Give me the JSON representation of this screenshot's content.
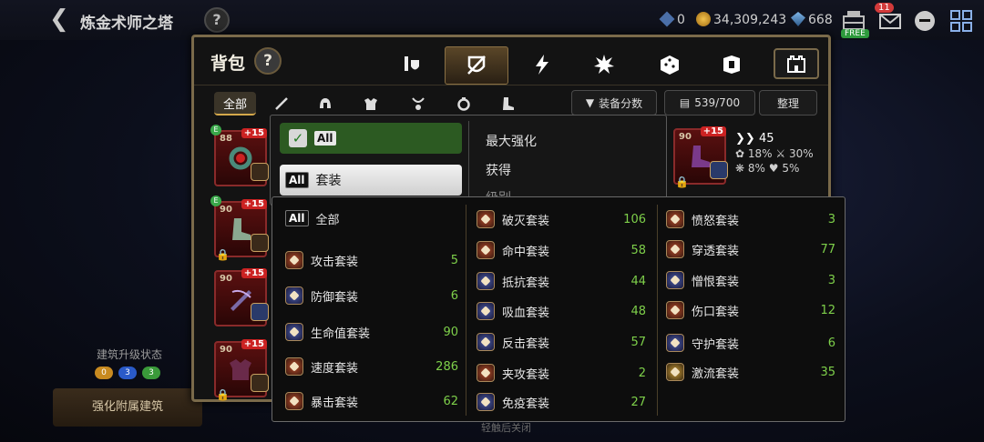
{
  "header": {
    "title": "炼金术师之塔",
    "help": "?",
    "resources": [
      {
        "icon": "blue-gem-icon",
        "value": "0"
      },
      {
        "icon": "gold-coin-icon",
        "value": "34,309,243"
      },
      {
        "icon": "crystal-icon",
        "value": "668"
      }
    ],
    "free_label": "FREE",
    "mail_badge": "11"
  },
  "background": {
    "building_status": "建筑升级状态",
    "dots": [
      "0",
      "3",
      "3"
    ],
    "strengthen_button": "强化附属建筑",
    "close_hint": "轻触后关闭"
  },
  "bag": {
    "title": "背包",
    "help": "?",
    "category_tabs": [
      "weapon-shield-icon",
      "armor-crossed-icon",
      "lightning-icon",
      "burst-icon",
      "dice-icon",
      "cube-icon",
      "castle-icon"
    ],
    "slot_tabs": [
      "全部",
      "sword-icon",
      "helmet-icon",
      "chest-armor-icon",
      "necklace-icon",
      "ring-icon",
      "boots-icon"
    ],
    "sort_button": "装备分数",
    "capacity": "539/700",
    "arrange_button": "整理",
    "items": [
      {
        "level": "88",
        "plus": "+15",
        "e": "E",
        "locked": false
      },
      {
        "level": "90",
        "plus": "+15",
        "e": "E",
        "locked": true
      },
      {
        "level": "90",
        "plus": "+15",
        "e": "",
        "locked": false
      },
      {
        "level": "90",
        "plus": "+15",
        "e": "",
        "locked": true
      }
    ],
    "right_item": {
      "level": "90",
      "plus": "+15",
      "locked": true
    },
    "stats": {
      "main": "45",
      "s1": "18%",
      "s2": "30%",
      "s3": "8%",
      "s4": "5%"
    }
  },
  "sort_menu": {
    "all_label": "All",
    "set_label": "套装",
    "options": [
      "最大强化",
      "获得",
      "级别"
    ]
  },
  "set_filter": {
    "all_label": "All",
    "all_text": "全部",
    "col1": [
      {
        "name": "攻击套装",
        "count": "5"
      },
      {
        "name": "防御套装",
        "count": "6"
      },
      {
        "name": "生命值套装",
        "count": "90"
      },
      {
        "name": "速度套装",
        "count": "286"
      },
      {
        "name": "暴击套装",
        "count": "62"
      }
    ],
    "col2": [
      {
        "name": "破灭套装",
        "count": "106"
      },
      {
        "name": "命中套装",
        "count": "58"
      },
      {
        "name": "抵抗套装",
        "count": "44"
      },
      {
        "name": "吸血套装",
        "count": "48"
      },
      {
        "name": "反击套装",
        "count": "57"
      },
      {
        "name": "夹攻套装",
        "count": "2"
      },
      {
        "name": "免疫套装",
        "count": "27"
      }
    ],
    "col3": [
      {
        "name": "愤怒套装",
        "count": "3"
      },
      {
        "name": "穿透套装",
        "count": "77"
      },
      {
        "name": "憎恨套装",
        "count": "3"
      },
      {
        "name": "伤口套装",
        "count": "12"
      },
      {
        "name": "守护套装",
        "count": "6"
      },
      {
        "name": "激流套装",
        "count": "35"
      }
    ]
  }
}
